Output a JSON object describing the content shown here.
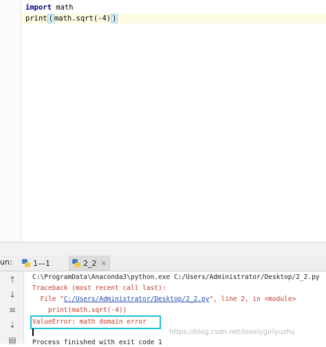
{
  "editor": {
    "line1_keyword": "import",
    "line1_rest": " math",
    "line2_prefix": "print",
    "line2_paren_open": "(",
    "line2_mid": "math.sqrt(-4)",
    "line2_paren_close": ")"
  },
  "run_panel": {
    "run_label": "un:",
    "tabs": [
      {
        "label": "1—1",
        "icon": "python-icon"
      },
      {
        "label": "2_2",
        "icon": "python-icon",
        "close": "×"
      }
    ]
  },
  "console": {
    "cmd_line": "C:\\ProgramData\\Anaconda3\\python.exe C:/Users/Administrator/Desktop/2_2.py",
    "traceback": "Traceback (most recent call last):",
    "file_prefix": "  File \"",
    "file_path": "C:/Users/Administrator/Desktop/2_2.py",
    "file_suffix": "\", line 2, in <module>",
    "code_line": "    print(math.sqrt(-4))",
    "error_line": "ValueError: math domain error",
    "finished_line": "Process finished with exit code 1"
  },
  "watermark": "https://blog.csdn.net/lovelygirlyuzhu",
  "colors": {
    "error_red": "#c0392b",
    "link_blue": "#2349b0",
    "highlight_cyan": "#19c0d6"
  }
}
